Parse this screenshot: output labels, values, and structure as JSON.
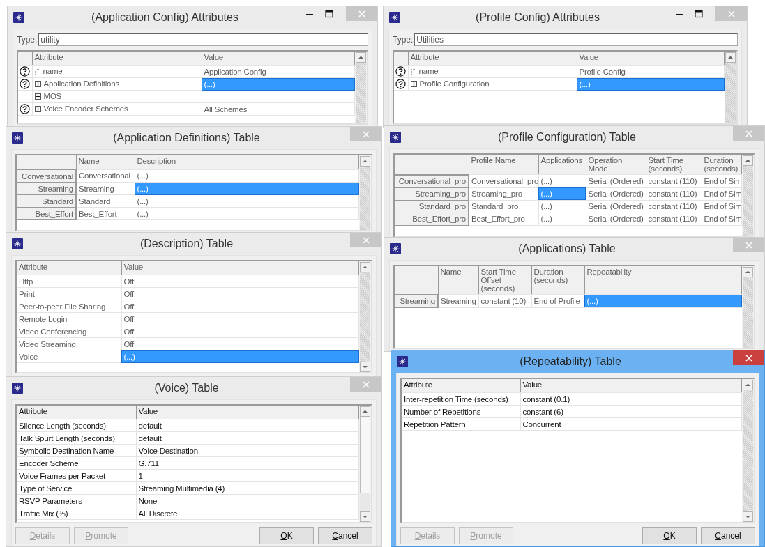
{
  "windows": [
    {
      "kind": "attributes",
      "title": "(Application Config) Attributes",
      "active": false,
      "disabled": true,
      "type_field": {
        "label": "Type:",
        "value": "utility"
      },
      "columns": [
        "Attribute",
        "Value"
      ],
      "rows": [
        {
          "help": true,
          "kind": "leaf",
          "attribute": "name",
          "value": "Application Config",
          "selected": false
        },
        {
          "help": true,
          "kind": "group",
          "attribute": "Application Definitions",
          "value": "(...)",
          "selected": true
        },
        {
          "help": false,
          "kind": "group",
          "attribute": "MOS",
          "selected": false
        },
        {
          "help": true,
          "kind": "group",
          "attribute": "Voice Encoder Schemes",
          "value": "All Schemes",
          "selected": false
        }
      ]
    },
    {
      "kind": "grid",
      "title": "(Application Definitions) Table",
      "active": false,
      "disabled": true,
      "columns": [
        "Name",
        "Description"
      ],
      "rows": [
        {
          "header": "Conversational",
          "cells": [
            {
              "text": "Conversational",
              "selected": false
            },
            {
              "text": "(...)",
              "selected": false
            }
          ]
        },
        {
          "header": "Streaming",
          "cells": [
            {
              "text": "Streaming",
              "selected": false
            },
            {
              "text": "(...)",
              "selected": true
            }
          ]
        },
        {
          "header": "Standard",
          "cells": [
            {
              "text": "Standard",
              "selected": false
            },
            {
              "text": "(...)",
              "selected": false
            }
          ]
        },
        {
          "header": "Best_Effort",
          "cells": [
            {
              "text": "Best_Effort",
              "selected": false
            },
            {
              "text": "(...)",
              "selected": false
            }
          ]
        }
      ]
    },
    {
      "kind": "list",
      "title": "(Description) Table",
      "active": false,
      "disabled": true,
      "columns": [
        "Attribute",
        "Value"
      ],
      "rows": [
        {
          "attribute": "Http",
          "value": "Off",
          "selected": false
        },
        {
          "attribute": "Print",
          "value": "Off",
          "selected": false
        },
        {
          "attribute": "Peer-to-peer File Sharing",
          "value": "Off",
          "selected": false
        },
        {
          "attribute": "Remote Login",
          "value": "Off",
          "selected": false
        },
        {
          "attribute": "Video Conferencing",
          "value": "Off",
          "selected": false
        },
        {
          "attribute": "Video Streaming",
          "value": "Off",
          "selected": false
        },
        {
          "attribute": "Voice",
          "value": "(...)",
          "selected": true
        }
      ]
    },
    {
      "kind": "list",
      "title": "(Voice) Table",
      "active": false,
      "disabled": false,
      "columns": [
        "Attribute",
        "Value"
      ],
      "rows": [
        {
          "attribute": "Silence Length (seconds)",
          "value": "default",
          "selected": false
        },
        {
          "attribute": "Talk Spurt Length (seconds)",
          "value": "default",
          "selected": false
        },
        {
          "attribute": "Symbolic Destination Name",
          "value": "Voice Destination",
          "selected": false
        },
        {
          "attribute": "Encoder Scheme",
          "value": "G.711",
          "selected": false
        },
        {
          "attribute": "Voice Frames per Packet",
          "value": "1",
          "selected": false
        },
        {
          "attribute": "Type of Service",
          "value": "Streaming Multimedia (4)",
          "selected": false
        },
        {
          "attribute": "RSVP Parameters",
          "value": "None",
          "selected": false
        },
        {
          "attribute": "Traffic Mix (%)",
          "value": "All Discrete",
          "selected": false
        }
      ],
      "buttons": [
        {
          "label": "Details",
          "disabled": true
        },
        {
          "label": "Promote",
          "disabled": true
        },
        {
          "label": "OK",
          "disabled": false
        },
        {
          "label": "Cancel",
          "disabled": false
        }
      ]
    },
    {
      "kind": "attributes",
      "title": "(Profile Config) Attributes",
      "active": false,
      "disabled": true,
      "type_field": {
        "label": "Type:",
        "value": "Utilities"
      },
      "columns": [
        "Attribute",
        "Value"
      ],
      "rows": [
        {
          "help": true,
          "kind": "leaf",
          "attribute": "name",
          "value": "Profile Config",
          "selected": false
        },
        {
          "help": true,
          "kind": "group",
          "attribute": "Profile Configuration",
          "value": "(...)",
          "selected": true
        }
      ]
    },
    {
      "kind": "grid",
      "title": "(Profile Configuration) Table",
      "active": false,
      "disabled": true,
      "columns": [
        "Profile Name",
        "Applications",
        "Operation Mode",
        "Start Time (seconds)",
        "Duration (seconds)"
      ],
      "rows": [
        {
          "header": "Conversational_pro",
          "cells": [
            {
              "text": "Conversational_pro",
              "selected": false
            },
            {
              "text": "(...)",
              "selected": false
            },
            {
              "text": "Serial (Ordered)",
              "selected": false
            },
            {
              "text": "constant (110)",
              "selected": false
            },
            {
              "text": "End of Sim",
              "selected": false
            }
          ]
        },
        {
          "header": "Streaming_pro",
          "cells": [
            {
              "text": "Streaming_pro",
              "selected": false
            },
            {
              "text": "(...)",
              "selected": true
            },
            {
              "text": "Serial (Ordered)",
              "selected": false
            },
            {
              "text": "constant (110)",
              "selected": false
            },
            {
              "text": "End of Sim",
              "selected": false
            }
          ]
        },
        {
          "header": "Standard_pro",
          "cells": [
            {
              "text": "Standard_pro",
              "selected": false
            },
            {
              "text": "(...)",
              "selected": false
            },
            {
              "text": "Serial (Ordered)",
              "selected": false
            },
            {
              "text": "constant (110)",
              "selected": false
            },
            {
              "text": "End of Sim",
              "selected": false
            }
          ]
        },
        {
          "header": "Best_Effort_pro",
          "cells": [
            {
              "text": "Best_Effort_pro",
              "selected": false
            },
            {
              "text": "(...)",
              "selected": false
            },
            {
              "text": "Serial (Ordered)",
              "selected": false
            },
            {
              "text": "constant (110)",
              "selected": false
            },
            {
              "text": "End of Sim",
              "selected": false
            }
          ]
        }
      ]
    },
    {
      "kind": "grid",
      "title": "(Applications) Table",
      "active": false,
      "disabled": true,
      "columns": [
        "Name",
        "Start Time Offset (seconds)",
        "Duration (seconds)",
        "Repeatability"
      ],
      "rows": [
        {
          "header": "Streaming",
          "cells": [
            {
              "text": "Streaming",
              "selected": false
            },
            {
              "text": "constant (10)",
              "selected": false
            },
            {
              "text": "End of Profile",
              "selected": false
            },
            {
              "text": "(...)",
              "selected": true
            }
          ]
        }
      ]
    },
    {
      "kind": "list",
      "title": "(Repeatability) Table",
      "active": true,
      "disabled": false,
      "columns": [
        "Attribute",
        "Value"
      ],
      "rows": [
        {
          "attribute": "Inter-repetition Time (seconds)",
          "value": "constant (0.1)",
          "selected": false
        },
        {
          "attribute": "Number of Repetitions",
          "value": "constant (6)",
          "selected": false
        },
        {
          "attribute": "Repetition Pattern",
          "value": "Concurrent",
          "selected": false
        }
      ],
      "buttons": [
        {
          "label": "Details",
          "disabled": true
        },
        {
          "label": "Promote",
          "disabled": true
        },
        {
          "label": "OK",
          "disabled": false
        },
        {
          "label": "Cancel",
          "disabled": false
        }
      ]
    }
  ]
}
